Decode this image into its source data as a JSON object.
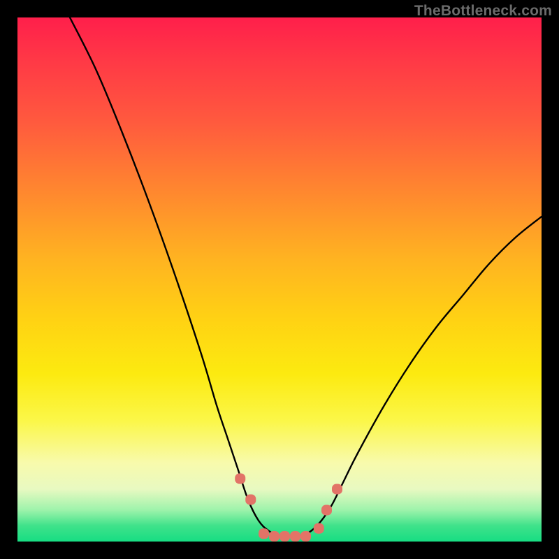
{
  "watermark": "TheBottleneck.com",
  "chart_data": {
    "type": "line",
    "title": "",
    "xlabel": "",
    "ylabel": "",
    "xlim": [
      0,
      100
    ],
    "ylim": [
      0,
      100
    ],
    "series": [
      {
        "name": "bottleneck-curve",
        "x": [
          10,
          15,
          20,
          25,
          30,
          35,
          38,
          40,
          42,
          44,
          46,
          48,
          50,
          52,
          54,
          56,
          58,
          60,
          62,
          65,
          70,
          75,
          80,
          85,
          90,
          95,
          100
        ],
        "y": [
          100,
          90,
          78,
          65,
          51,
          36,
          26,
          20,
          14,
          8,
          4,
          2,
          1,
          1,
          1,
          2,
          4,
          7,
          11,
          17,
          26,
          34,
          41,
          47,
          53,
          58,
          62
        ]
      }
    ],
    "markers": {
      "name": "highlight-points",
      "x": [
        42.5,
        44.5,
        47,
        49,
        51,
        53,
        55,
        57.5,
        59,
        61
      ],
      "y": [
        12,
        8,
        1.5,
        1,
        1,
        1,
        1,
        2.5,
        6,
        10
      ]
    },
    "colors": {
      "curve": "#000000",
      "marker": "#e27367",
      "gradient_top": "#ff1f4b",
      "gradient_bottom": "#17dd83"
    }
  }
}
